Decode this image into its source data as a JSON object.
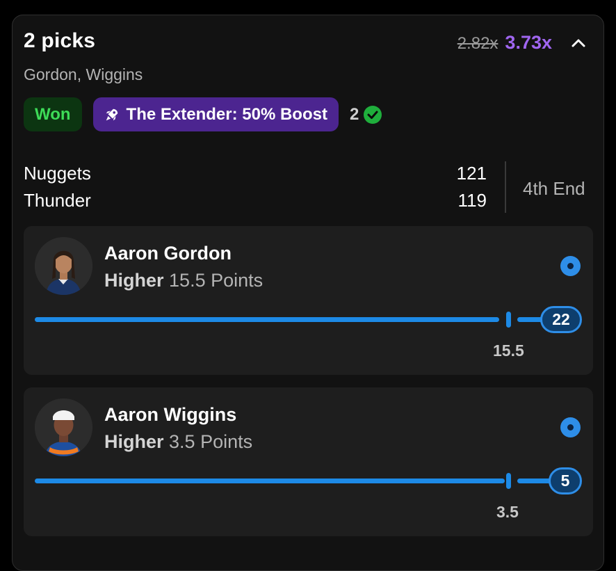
{
  "header": {
    "title": "2 picks",
    "players_summary": "Gordon, Wiggins",
    "old_multiplier": "2.82x",
    "new_multiplier": "3.73x"
  },
  "badges": {
    "result": "Won",
    "boost": "The Extender: 50% Boost",
    "correct_count": "2"
  },
  "game": {
    "teams": [
      {
        "name": "Nuggets",
        "score": "121"
      },
      {
        "name": "Thunder",
        "score": "119"
      }
    ],
    "status": "4th End"
  },
  "picks": [
    {
      "player": "Aaron Gordon",
      "direction": "Higher",
      "line_text": "15.5 Points",
      "line_value": "15.5",
      "actual": "22",
      "progress": 1.0
    },
    {
      "player": "Aaron Wiggins",
      "direction": "Higher",
      "line_text": "3.5 Points",
      "line_value": "3.5",
      "actual": "5",
      "progress": 1.0
    }
  ],
  "colors": {
    "accent_blue": "#1d8ae6",
    "boost_purple": "#4c2590",
    "multiplier_purple": "#a066f0",
    "won_green": "#3ddc57"
  }
}
